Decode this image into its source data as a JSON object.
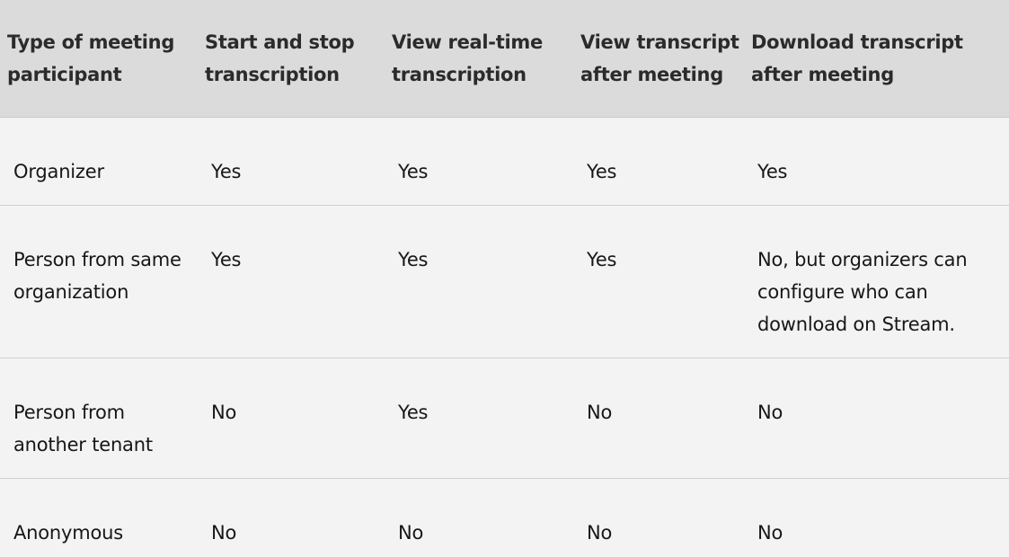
{
  "table": {
    "headers": [
      "Type of meeting participant",
      "Start and stop transcription",
      "View real-time transcription",
      "View transcript after meeting",
      "Download transcript after meeting"
    ],
    "rows": [
      [
        "Organizer",
        "Yes",
        "Yes",
        "Yes",
        "Yes"
      ],
      [
        "Person from same organization",
        "Yes",
        "Yes",
        "Yes",
        "No, but organizers can configure who can download on Stream."
      ],
      [
        "Person from another tenant",
        "No",
        "Yes",
        "No",
        "No"
      ],
      [
        "Anonymous",
        "No",
        "No",
        "No",
        "No"
      ]
    ]
  }
}
